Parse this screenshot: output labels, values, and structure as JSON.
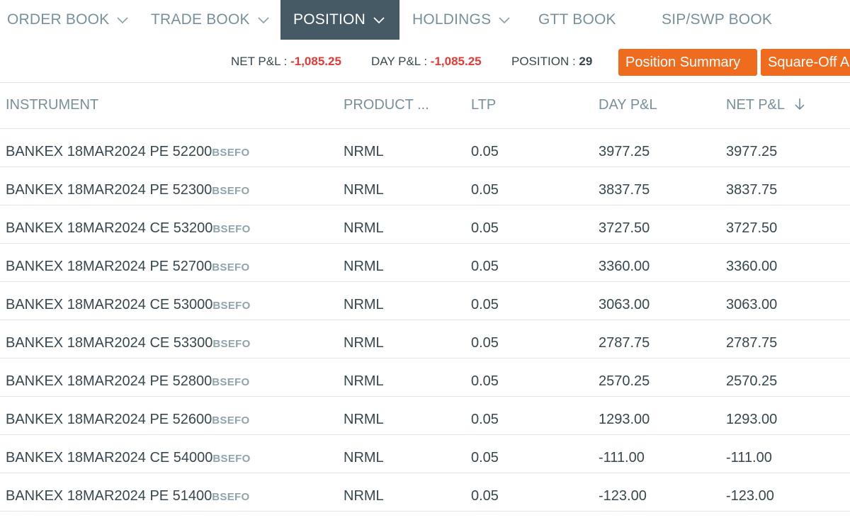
{
  "tabs": [
    {
      "label": "ORDER BOOK",
      "has_dropdown": true,
      "active": false
    },
    {
      "label": "TRADE BOOK",
      "has_dropdown": true,
      "active": false
    },
    {
      "label": "POSITION",
      "has_dropdown": true,
      "active": true
    },
    {
      "label": "HOLDINGS",
      "has_dropdown": true,
      "active": false
    },
    {
      "label": "GTT BOOK",
      "has_dropdown": false,
      "active": false
    },
    {
      "label": "SIP/SWP BOOK",
      "has_dropdown": false,
      "active": false
    }
  ],
  "summary": {
    "net_pl_label": "NET P&L : ",
    "net_pl_value": "-1,085.25",
    "day_pl_label": "DAY P&L : ",
    "day_pl_value": "-1,085.25",
    "position_label": "POSITION : ",
    "position_value": "29"
  },
  "buttons": {
    "position_summary": "Position Summary",
    "square_off": "Square-Off A"
  },
  "table": {
    "headers": {
      "instrument": "INSTRUMENT",
      "product": "PRODUCT ...",
      "ltp": "LTP",
      "day_pl": "DAY P&L",
      "net_pl": "NET P&L"
    },
    "rows": [
      {
        "instrument": "BANKEX 18MAR2024 PE 52200",
        "exchange": "BSEFO",
        "product": "NRML",
        "ltp": "0.05",
        "day_pl": "3977.25",
        "net_pl": "3977.25"
      },
      {
        "instrument": "BANKEX 18MAR2024 PE 52300",
        "exchange": "BSEFO",
        "product": "NRML",
        "ltp": "0.05",
        "day_pl": "3837.75",
        "net_pl": "3837.75"
      },
      {
        "instrument": "BANKEX 18MAR2024 CE 53200",
        "exchange": "BSEFO",
        "product": "NRML",
        "ltp": "0.05",
        "day_pl": "3727.50",
        "net_pl": "3727.50"
      },
      {
        "instrument": "BANKEX 18MAR2024 PE 52700",
        "exchange": "BSEFO",
        "product": "NRML",
        "ltp": "0.05",
        "day_pl": "3360.00",
        "net_pl": "3360.00"
      },
      {
        "instrument": "BANKEX 18MAR2024 CE 53000",
        "exchange": "BSEFO",
        "product": "NRML",
        "ltp": "0.05",
        "day_pl": "3063.00",
        "net_pl": "3063.00"
      },
      {
        "instrument": "BANKEX 18MAR2024 CE 53300",
        "exchange": "BSEFO",
        "product": "NRML",
        "ltp": "0.05",
        "day_pl": "2787.75",
        "net_pl": "2787.75"
      },
      {
        "instrument": "BANKEX 18MAR2024 PE 52800",
        "exchange": "BSEFO",
        "product": "NRML",
        "ltp": "0.05",
        "day_pl": "2570.25",
        "net_pl": "2570.25"
      },
      {
        "instrument": "BANKEX 18MAR2024 PE 52600",
        "exchange": "BSEFO",
        "product": "NRML",
        "ltp": "0.05",
        "day_pl": "1293.00",
        "net_pl": "1293.00"
      },
      {
        "instrument": "BANKEX 18MAR2024 CE 54000",
        "exchange": "BSEFO",
        "product": "NRML",
        "ltp": "0.05",
        "day_pl": "-111.00",
        "net_pl": "-111.00"
      },
      {
        "instrument": "BANKEX 18MAR2024 PE 51400",
        "exchange": "BSEFO",
        "product": "NRML",
        "ltp": "0.05",
        "day_pl": "-123.00",
        "net_pl": "-123.00"
      }
    ]
  },
  "colors": {
    "active_tab_bg": "#455a64",
    "button_bg": "#ef6c1f",
    "negative": "#e53935"
  }
}
